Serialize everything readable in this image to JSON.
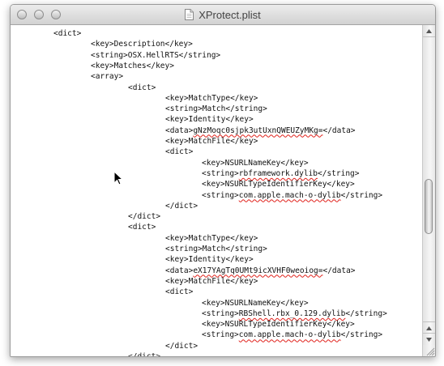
{
  "window": {
    "title": "XProtect.plist",
    "icons": {
      "close": "close-button-icon",
      "minimize": "minimize-button-icon",
      "zoom": "zoom-button-icon",
      "document": "plist-document-icon",
      "cursor": "arrow-cursor-icon"
    }
  },
  "editor": {
    "lines": [
      [
        "<dict>"
      ],
      [
        "<key>Description</key>"
      ],
      [
        "<string>OSX.HellRTS</string>"
      ],
      [
        "<key>Matches</key>"
      ],
      [
        "<array>"
      ],
      [
        "<dict>"
      ],
      [
        "<key>MatchType</key>"
      ],
      [
        "<string>Match</string>"
      ],
      [
        "<key>Identity</key>"
      ],
      [
        "<data>",
        "gNzMoqc0sjpk3utUxnQWEUZyMKg=",
        "</data>"
      ],
      [
        "<key>MatchFile</key>"
      ],
      [
        "<dict>"
      ],
      [
        "<key>NSURLNameKey</key>"
      ],
      [
        "<string>",
        "rbframework.dylib",
        "</string>"
      ],
      [
        "<key>NSURLTypeIdentifierKey</key>"
      ],
      [
        "<string>",
        "com.apple.mach-o-dylib",
        "</string>"
      ],
      [
        "</dict>"
      ],
      [
        "</dict>"
      ],
      [
        "<dict>"
      ],
      [
        "<key>MatchType</key>"
      ],
      [
        "<string>Match</string>"
      ],
      [
        "<key>Identity</key>"
      ],
      [
        "<data>",
        "eX17YAgTq0UMt9icXVHF0weoiog=",
        "</data>"
      ],
      [
        "<key>MatchFile</key>"
      ],
      [
        "<dict>"
      ],
      [
        "<key>NSURLNameKey</key>"
      ],
      [
        "<string>",
        "RBShell.rbx_0.129.dylib",
        "</string>"
      ],
      [
        "<key>NSURLTypeIdentifierKey</key>"
      ],
      [
        "<string>",
        "com.apple.mach-o-dylib",
        "</string>"
      ],
      [
        "</dict>"
      ],
      [
        "</dict>"
      ]
    ]
  },
  "scrollbar": {
    "position_fraction": 0.48,
    "icons": {
      "up": "scroll-up-arrow-icon",
      "down": "scroll-down-arrow-icon",
      "resize": "resize-grip-icon"
    }
  }
}
